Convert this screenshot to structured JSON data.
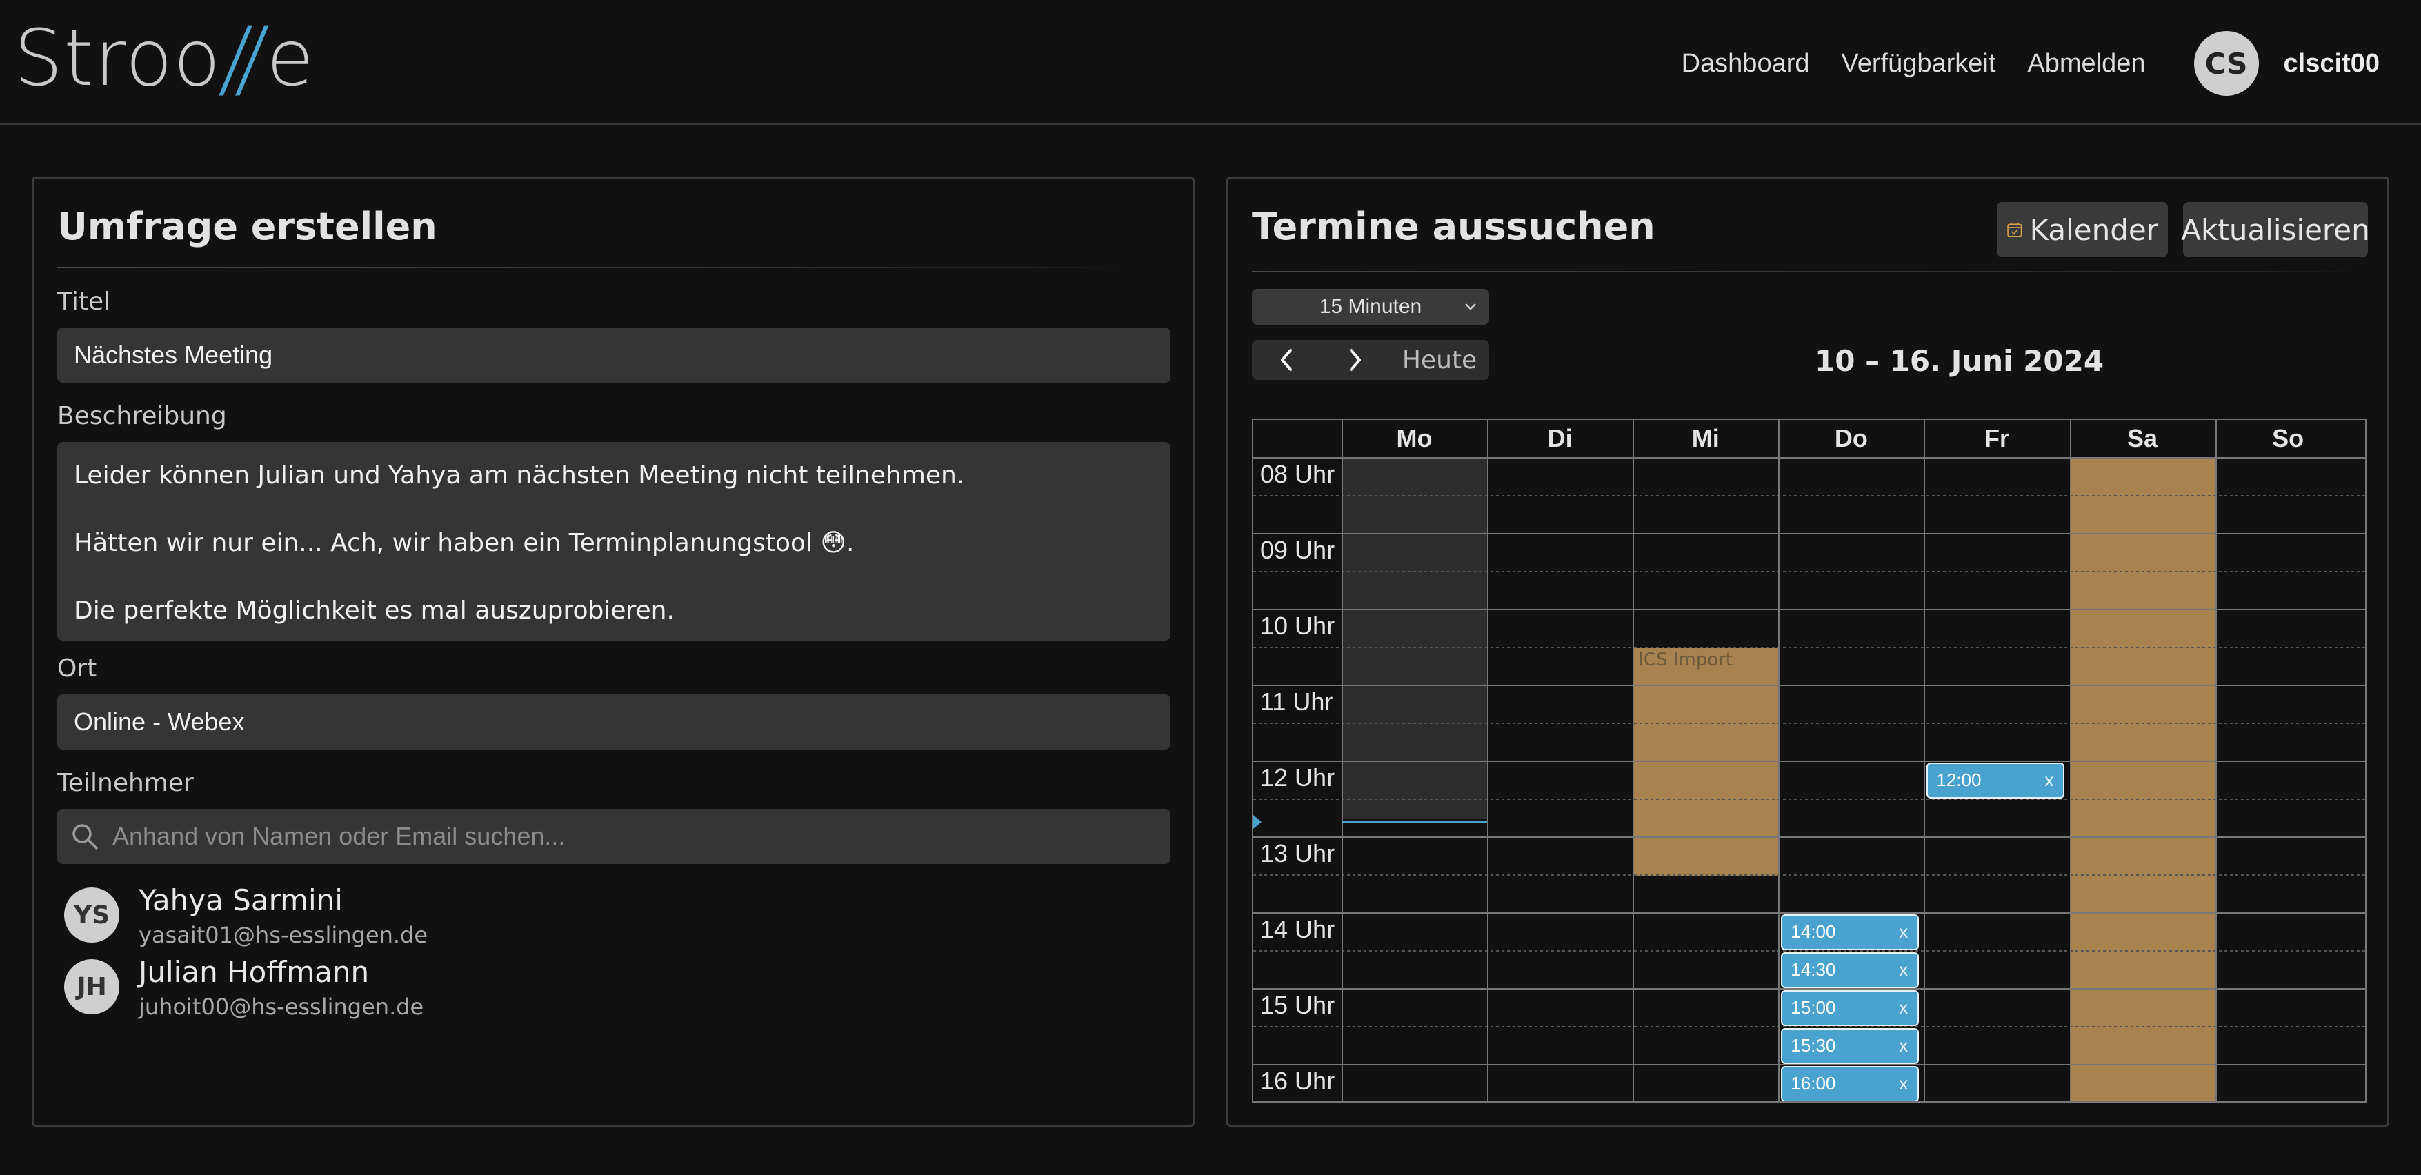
{
  "header": {
    "logo_prefix": "Stroo",
    "logo_slash": "//",
    "logo_suffix": "e",
    "nav": [
      {
        "label": "Dashboard"
      },
      {
        "label": "Verfügbarkeit"
      },
      {
        "label": "Abmelden"
      }
    ],
    "user": {
      "initials": "CS",
      "name": "clscit00"
    }
  },
  "left": {
    "title": "Umfrage erstellen",
    "titel_label": "Titel",
    "titel_value": "Nächstes Meeting",
    "beschreibung_label": "Beschreibung",
    "beschreibung_lines": [
      "Leider können Julian und Yahya am nächsten Meeting nicht teilnehmen.",
      "Hätten wir nur ein...  Ach, wir haben ein Terminplanungstool 😳.",
      "Die perfekte Möglichkeit es mal auszuprobieren."
    ],
    "ort_label": "Ort",
    "ort_value": "Online - Webex",
    "teilnehmer_label": "Teilnehmer",
    "search_placeholder": "Anhand von Namen oder Email suchen...",
    "participants": [
      {
        "initials": "YS",
        "name": "Yahya Sarmini",
        "email": "yasait01@hs-esslingen.de"
      },
      {
        "initials": "JH",
        "name": "Julian Hoffmann",
        "email": "juhoit00@hs-esslingen.de"
      }
    ]
  },
  "right": {
    "title": "Termine aussuchen",
    "kalender_label": "Kalender",
    "aktualisieren_label": "Aktualisieren",
    "interval_value": "15 Minuten",
    "today_label": "Heute",
    "range": "10 – 16. Juni 2024",
    "days": [
      "Mo",
      "Di",
      "Mi",
      "Do",
      "Fr",
      "Sa",
      "So"
    ],
    "hours": [
      "08 Uhr",
      "09 Uhr",
      "10 Uhr",
      "11 Uhr",
      "12 Uhr",
      "13 Uhr",
      "14 Uhr",
      "15 Uhr",
      "16 Uhr"
    ],
    "ics_label": "ICS Import",
    "remove_label": "x",
    "events": [
      {
        "day": "Fr",
        "time": "12:00"
      },
      {
        "day": "Do",
        "time": "14:00"
      },
      {
        "day": "Do",
        "time": "14:30"
      },
      {
        "day": "Do",
        "time": "15:00"
      },
      {
        "day": "Do",
        "time": "15:30"
      },
      {
        "day": "Do",
        "time": "16:00"
      }
    ]
  },
  "colors": {
    "background": "#111111",
    "accent_blue": "#4aa3cf",
    "busy_orange": "#a8824f",
    "input_bg": "#353535"
  }
}
